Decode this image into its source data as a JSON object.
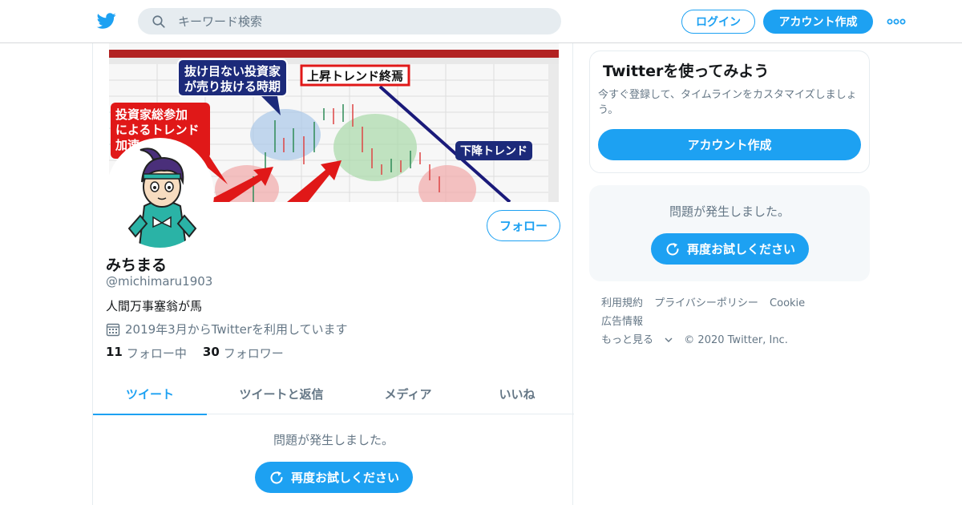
{
  "colors": {
    "accent": "#1da1f2",
    "text_primary": "#14171a",
    "text_secondary": "#657786",
    "border": "#e6ecf0"
  },
  "nav": {
    "logo_icon": "twitter-bird-icon",
    "search_placeholder": "キーワード検索",
    "login_label": "ログイン",
    "signup_label": "アカウント作成",
    "more_icon": "more-dots-icon"
  },
  "banner": {
    "chart_labels": {
      "callout_1": "抜け目ない投資家が売り抜ける時期",
      "callout_1a": "抜け目ない投資家",
      "callout_1b": "が売り抜ける時期",
      "callout_2": "上昇トレンド終焉",
      "callout_3a": "投資家総参加",
      "callout_3b": "によるトレンド",
      "callout_3c": "加速",
      "callout_4": "下降トレンド"
    }
  },
  "profile": {
    "name": "みちまる",
    "handle": "@michimaru1903",
    "bio": "人間万事塞翁が馬",
    "joined": "2019年3月からTwitterを利用しています",
    "following_count": "11",
    "following_label": "フォロー中",
    "followers_count": "30",
    "followers_label": "フォロワー",
    "follow_label": "フォロー"
  },
  "tabs": [
    {
      "label": "ツイート",
      "active": true
    },
    {
      "label": "ツイートと返信",
      "active": false
    },
    {
      "label": "メディア",
      "active": false
    },
    {
      "label": "いいね",
      "active": false
    }
  ],
  "timeline": {
    "error_message": "問題が発生しました。",
    "retry_label": "再度お試しください"
  },
  "sidebar": {
    "signup_title": "Twitterを使ってみよう",
    "signup_desc": "今すぐ登録して、タイムラインをカスタマイズしましょう。",
    "signup_button": "アカウント作成",
    "error_message": "問題が発生しました。",
    "retry_label": "再度お試しください",
    "footer": {
      "terms": "利用規約",
      "privacy": "プライバシーポリシー",
      "cookie": "Cookie",
      "ads": "広告情報",
      "more": "もっと見る",
      "copyright": "© 2020 Twitter, Inc."
    }
  }
}
